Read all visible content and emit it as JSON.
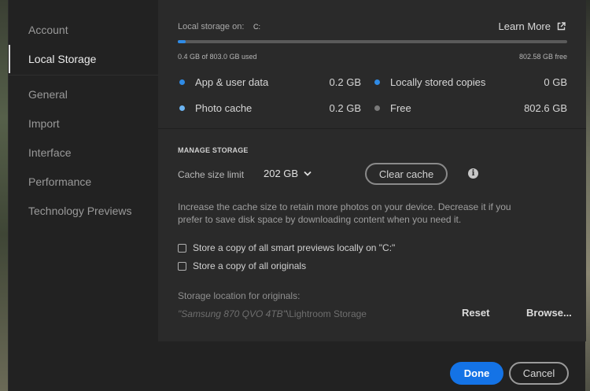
{
  "sidebar": {
    "items": [
      {
        "label": "Account"
      },
      {
        "label": "Local Storage"
      },
      {
        "label": "General"
      },
      {
        "label": "Import"
      },
      {
        "label": "Interface"
      },
      {
        "label": "Performance"
      },
      {
        "label": "Technology Previews"
      }
    ],
    "active_index": 1
  },
  "storage": {
    "label": "Local storage on:",
    "drive": "C:",
    "learn_more": "Learn More",
    "used_text": "0.4 GB of 803.0 GB used",
    "free_text": "802.58 GB free",
    "used_fraction": 0.0005
  },
  "legend": [
    {
      "label": "App & user data",
      "value": "0.2 GB",
      "color": "#2f8be6"
    },
    {
      "label": "Photo cache",
      "value": "0.2 GB",
      "color": "#6cb4f2"
    },
    {
      "label": "Locally stored copies",
      "value": "0 GB",
      "color": "#2f8be6"
    },
    {
      "label": "Free",
      "value": "802.6 GB",
      "color": "#7a7a7a"
    }
  ],
  "manage": {
    "title": "MANAGE STORAGE",
    "cache_label": "Cache size limit",
    "cache_value": "202 GB",
    "clear_cache": "Clear cache",
    "description": "Increase the cache size to retain more photos on your device. Decrease it if you prefer to save disk space by downloading content when you need it.",
    "checkbox_previews": "Store a copy of all smart previews locally on \"C:\"",
    "checkbox_originals": "Store a copy of all originals",
    "location_label": "Storage location for originals:",
    "location_drive": "\"Samsung 870 QVO 4TB\"",
    "location_path": "\\Lightroom Storage",
    "reset": "Reset",
    "browse": "Browse..."
  },
  "footer": {
    "done": "Done",
    "cancel": "Cancel"
  },
  "colors": {
    "accent": "#1473e6",
    "bar_fill": "#2f8be6",
    "panel": "#2a2a2a"
  }
}
